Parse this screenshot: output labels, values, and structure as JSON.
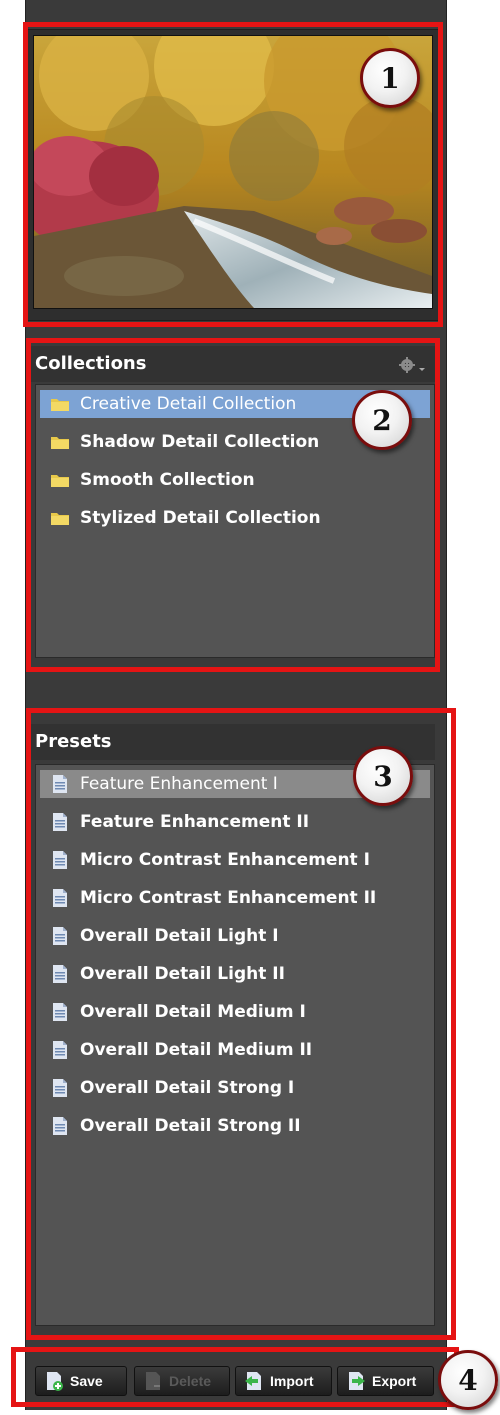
{
  "collections": {
    "header": "Collections",
    "gear_icon": "gear-icon",
    "items": [
      {
        "label": "Creative Detail Collection",
        "icon": "folder-icon"
      },
      {
        "label": "Shadow Detail Collection",
        "icon": "folder-icon"
      },
      {
        "label": "Smooth Collection",
        "icon": "folder-icon"
      },
      {
        "label": "Stylized Detail Collection",
        "icon": "folder-icon"
      }
    ]
  },
  "presets": {
    "header": "Presets",
    "items": [
      {
        "label": "Feature Enhancement I",
        "icon": "document-icon"
      },
      {
        "label": "Feature Enhancement II",
        "icon": "document-icon"
      },
      {
        "label": "Micro Contrast Enhancement I",
        "icon": "document-icon"
      },
      {
        "label": "Micro Contrast Enhancement II",
        "icon": "document-icon"
      },
      {
        "label": "Overall Detail Light I",
        "icon": "document-icon"
      },
      {
        "label": "Overall Detail Light II",
        "icon": "document-icon"
      },
      {
        "label": "Overall Detail Medium I",
        "icon": "document-icon"
      },
      {
        "label": "Overall Detail Medium II",
        "icon": "document-icon"
      },
      {
        "label": "Overall Detail Strong I",
        "icon": "document-icon"
      },
      {
        "label": "Overall Detail Strong II",
        "icon": "document-icon"
      }
    ]
  },
  "toolbar": {
    "save_label": "Save",
    "delete_label": "Delete",
    "import_label": "Import",
    "export_label": "Export"
  },
  "callouts": [
    "1",
    "2",
    "3",
    "4"
  ],
  "colors": {
    "highlight": "#e51414",
    "selection_blue": "#7da3d4",
    "selection_gray": "#8a8a8a",
    "panel": "#3a3a3a",
    "list_bg": "#545454"
  }
}
